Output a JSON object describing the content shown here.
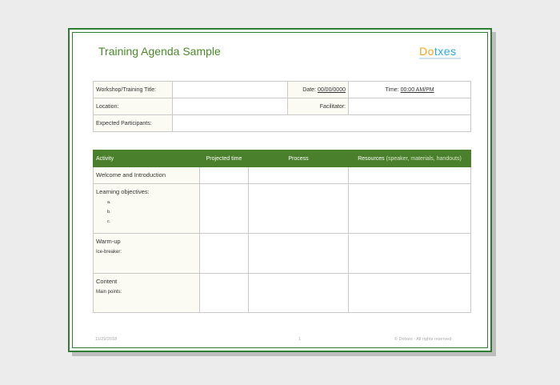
{
  "title": "Training Agenda Sample",
  "logo": {
    "d": "D",
    "o": "o",
    "rest": "txes"
  },
  "info": {
    "workshop_label": "Workshop/Training Title:",
    "date_label": "Date:",
    "date_value": "00/00/0000",
    "time_label": "Time:",
    "time_value": "00:00 AM/PM",
    "location_label": "Location:",
    "facilitator_label": "Facilitator:",
    "participants_label": "Expected Participants:"
  },
  "agenda": {
    "headers": {
      "activity": "Activity",
      "projected_time": "Projected time",
      "process": "Process",
      "resources": "Resources",
      "resources_sub": "(speaker, materials, handouts)"
    },
    "rows": [
      {
        "main": "Welcome and Introduction"
      },
      {
        "main": "Learning objectives:",
        "items": [
          "a.",
          "b.",
          "c."
        ]
      },
      {
        "main": "Warm-up",
        "sub": "Ice-breaker:"
      },
      {
        "main": "Content",
        "sub": "Main points:"
      }
    ]
  },
  "footer": {
    "date": "11/29/2018",
    "page": "1",
    "copyright": "© Dotxes - All rights reserved"
  },
  "colors": {
    "accent": "#4a7f2b",
    "border": "#2e7d32",
    "title": "#4a8a2a"
  }
}
